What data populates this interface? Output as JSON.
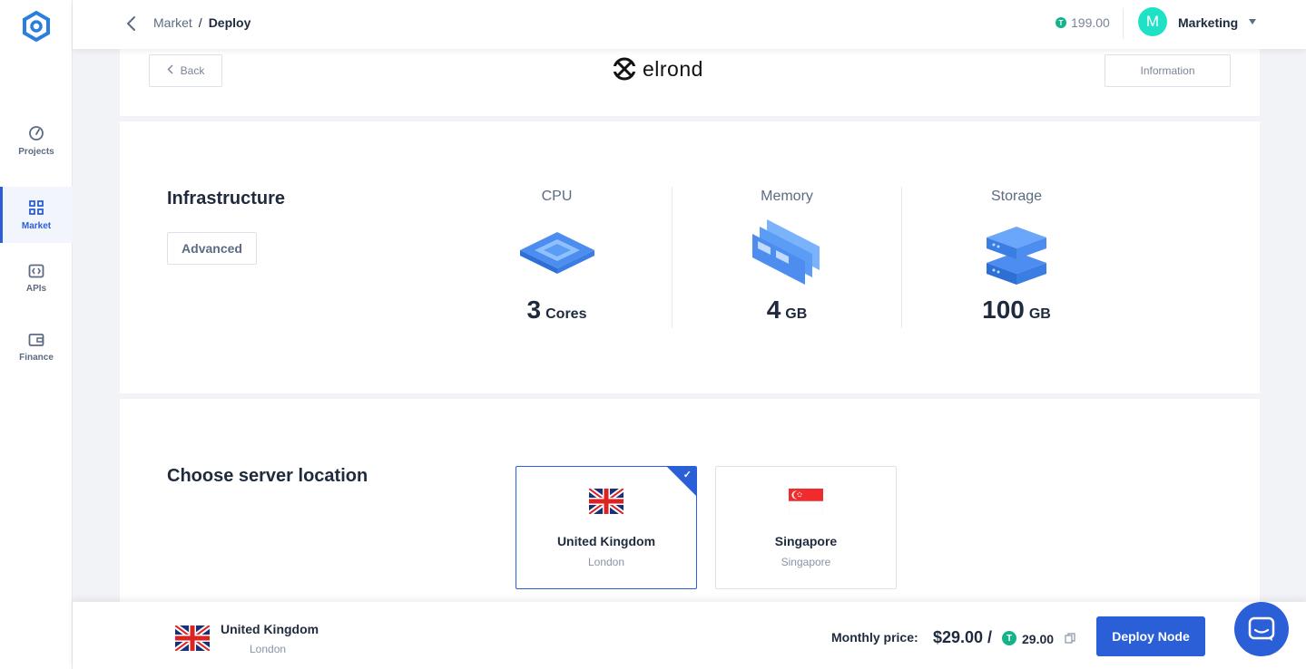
{
  "sidebar": {
    "logo": "logo-icon",
    "items": [
      {
        "label": "Projects",
        "icon": "speedometer-icon",
        "active": false
      },
      {
        "label": "Market",
        "icon": "grid-icon",
        "active": true
      },
      {
        "label": "APIs",
        "icon": "code-icon",
        "active": false
      },
      {
        "label": "Finance",
        "icon": "wallet-icon",
        "active": false
      }
    ]
  },
  "header": {
    "breadcrumb": {
      "parent": "Market",
      "separator": "/",
      "current": "Deploy"
    },
    "balance": "199.00",
    "balance_coin": "T",
    "account_initial": "M",
    "account_name": "Marketing"
  },
  "deploy_header": {
    "back_label": "Back",
    "brand": "elrond",
    "info_label": "Information"
  },
  "infrastructure": {
    "title": "Infrastructure",
    "advanced_label": "Advanced",
    "resources": [
      {
        "label": "CPU",
        "value": "3",
        "unit": "Cores",
        "icon": "cpu-chip-icon"
      },
      {
        "label": "Memory",
        "value": "4",
        "unit": "GB",
        "icon": "memory-module-icon"
      },
      {
        "label": "Storage",
        "value": "100",
        "unit": "GB",
        "icon": "server-stack-icon"
      }
    ]
  },
  "location": {
    "title": "Choose server location",
    "options": [
      {
        "country": "United Kingdom",
        "city": "London",
        "flag": "uk-flag-icon",
        "selected": true
      },
      {
        "country": "Singapore",
        "city": "Singapore",
        "flag": "singapore-flag-icon",
        "selected": false
      }
    ]
  },
  "footer": {
    "selected_country": "United Kingdom",
    "selected_city": "London",
    "monthly_label": "Monthly price:",
    "price_usd": "$29.00 /",
    "price_token": "29.00",
    "coin": "T",
    "deploy_label": "Deploy Node"
  },
  "colors": {
    "accent": "#2a5fd8",
    "token": "#16b28a",
    "avatar": "#1fe1c5"
  }
}
